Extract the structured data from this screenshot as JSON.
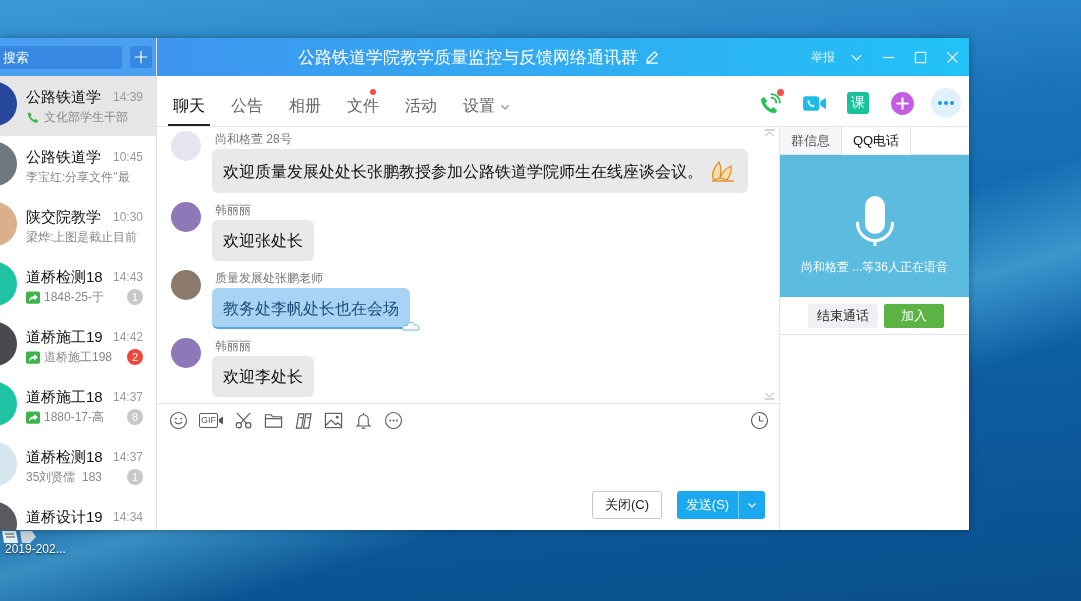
{
  "desktop": {
    "shortcut": {
      "label": "2019-202..."
    }
  },
  "window": {
    "title": "公路铁道学院教学质量监控与反馈网络通讯群",
    "report": "举报"
  },
  "sidebar": {
    "search": {
      "placeholder": "搜索"
    },
    "chats": [
      {
        "name": "公路铁道学",
        "time": "14:39",
        "kind": "call",
        "preview": "文化部学生干部",
        "selected": true,
        "color": "#27479a"
      },
      {
        "name": "公路铁道学",
        "time": "10:45",
        "kind": "text",
        "preview": "李宝红:分享文件\"最",
        "selected": false,
        "color": "#6e787e"
      },
      {
        "name": "陕交院教学",
        "time": "10:30",
        "kind": "text",
        "preview": "梁烨:上图是截止目前",
        "selected": false,
        "color": "#d9b08c"
      },
      {
        "name": "道桥检测18",
        "time": "14:43",
        "kind": "shared",
        "preview": "1848-25-于",
        "badge": {
          "text": "1",
          "color": "#c8c8c8"
        },
        "selected": false,
        "color": "#1fc4a4"
      },
      {
        "name": "道桥施工19",
        "time": "14:42",
        "kind": "shared",
        "preview": "道桥施工198",
        "badge": {
          "text": "2",
          "color": "#f0473a"
        },
        "selected": false,
        "color": "#4a4a4e"
      },
      {
        "name": "道桥施工18",
        "time": "14:37",
        "kind": "shared",
        "preview": "1880-17-高",
        "badge": {
          "text": "8",
          "color": "#c8c8c8"
        },
        "selected": false,
        "color": "#1fc4a4"
      },
      {
        "name": "道桥检测18",
        "time": "14:37",
        "kind": "text",
        "preview": "35刘贤儒  183",
        "badge": {
          "text": "1",
          "color": "#c8c8c8"
        },
        "selected": false,
        "color": "#d6e6f0"
      },
      {
        "name": "道桥设计19",
        "time": "14:34",
        "selected": false,
        "color": "#5a5a5e"
      }
    ]
  },
  "tabs": [
    {
      "label": "聊天",
      "selected": true,
      "dot": false,
      "dropdown": false
    },
    {
      "label": "公告",
      "selected": false,
      "dot": false,
      "dropdown": false
    },
    {
      "label": "相册",
      "selected": false,
      "dot": false,
      "dropdown": false
    },
    {
      "label": "文件",
      "selected": false,
      "dot": true,
      "dropdown": false
    },
    {
      "label": "活动",
      "selected": false,
      "dot": false,
      "dropdown": false
    },
    {
      "label": "设置",
      "selected": false,
      "dot": false,
      "dropdown": true
    }
  ],
  "actions": [
    {
      "kind": "voice-call",
      "dot": true
    },
    {
      "kind": "video-call",
      "dot": false
    },
    {
      "kind": "lesson",
      "label": "课"
    },
    {
      "kind": "add"
    },
    {
      "kind": "more"
    }
  ],
  "messages": [
    {
      "sender": "尚和格萱 28号",
      "text": "欢迎质量发展处处长张鹏教授参加公路铁道学院师生在线座谈会议。",
      "kind": "plain",
      "emoji": true,
      "color": "#e6e4ef"
    },
    {
      "sender": "韩丽丽",
      "text": "欢迎张处长",
      "kind": "plain",
      "emoji": false,
      "color": "#8e78b8"
    },
    {
      "sender": "质量发展处张鹏老师",
      "text": "教务处李帆处长也在会场",
      "kind": "cloud",
      "emoji": false,
      "color": "#8b7a6c"
    },
    {
      "sender": "韩丽丽",
      "text": "欢迎李处长",
      "kind": "plain",
      "emoji": false,
      "color": "#8e78b8"
    }
  ],
  "composer": {
    "tools": [
      {
        "kind": "emoji"
      },
      {
        "kind": "gif",
        "label": "GIF"
      },
      {
        "kind": "scissors"
      },
      {
        "kind": "folder"
      },
      {
        "kind": "docs"
      },
      {
        "kind": "image"
      },
      {
        "kind": "bell"
      },
      {
        "kind": "more"
      },
      {
        "kind": "history"
      }
    ],
    "buttons": [
      {
        "label": "关闭(C)",
        "kind": "secondary",
        "menu": false
      },
      {
        "label": "发送(S)",
        "kind": "primary",
        "menu": true
      }
    ]
  },
  "side_panel": {
    "tabs": [
      {
        "label": "群信息",
        "selected": false
      },
      {
        "label": "QQ电话",
        "selected": true
      }
    ],
    "status": "尚和格萱 ...等36人正在语音",
    "buttons": [
      {
        "label": "结束通话",
        "kind": "secondary"
      },
      {
        "label": "加入",
        "kind": "primary"
      }
    ]
  }
}
